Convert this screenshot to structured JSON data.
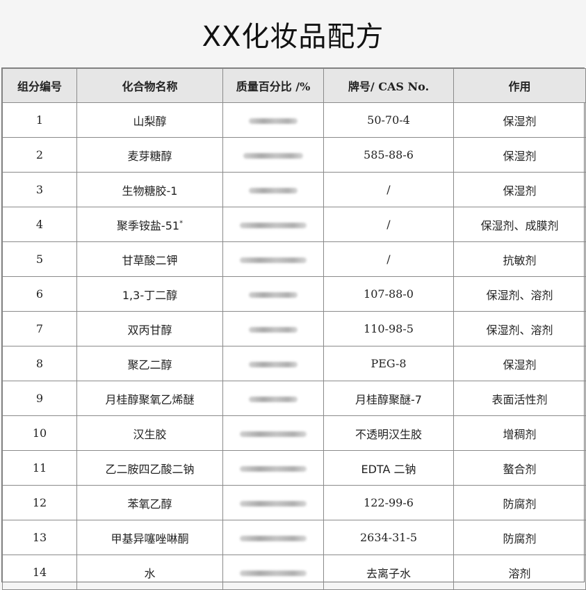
{
  "title": "XX化妆品配方",
  "columns": [
    "组分编号",
    "化合物名称",
    "质量百分比 /%",
    "牌号/ CAS No.",
    "作用"
  ],
  "rows": [
    {
      "id": "1",
      "name": "山梨醇",
      "sup": "",
      "cas": "50-70-4",
      "role": "保湿剂"
    },
    {
      "id": "2",
      "name": "麦芽糖醇",
      "sup": "",
      "cas": "585-88-6",
      "role": "保湿剂"
    },
    {
      "id": "3",
      "name": "生物糖胶-1",
      "sup": "",
      "cas": "/",
      "role": "保湿剂"
    },
    {
      "id": "4",
      "name": "聚季铵盐-51",
      "sup": "*",
      "cas": "/",
      "role": "保湿剂、成膜剂"
    },
    {
      "id": "5",
      "name": "甘草酸二钾",
      "sup": "",
      "cas": "/",
      "role": "抗敏剂"
    },
    {
      "id": "6",
      "name": "1,3-丁二醇",
      "sup": "",
      "cas": "107-88-0",
      "role": "保湿剂、溶剂"
    },
    {
      "id": "7",
      "name": "双丙甘醇",
      "sup": "",
      "cas": "110-98-5",
      "role": "保湿剂、溶剂"
    },
    {
      "id": "8",
      "name": "聚乙二醇",
      "sup": "",
      "cas": "PEG-8",
      "role": "保湿剂"
    },
    {
      "id": "9",
      "name": "月桂醇聚氧乙烯醚",
      "sup": "",
      "cas": "月桂醇聚醚-7",
      "role": "表面活性剂"
    },
    {
      "id": "10",
      "name": "汉生胶",
      "sup": "",
      "cas": "不透明汉生胶",
      "role": "增稠剂"
    },
    {
      "id": "11",
      "name": "乙二胺四乙酸二钠",
      "sup": "",
      "cas": "EDTA 二钠",
      "role": "螯合剂"
    },
    {
      "id": "12",
      "name": "苯氧乙醇",
      "sup": "",
      "cas": "122-99-6",
      "role": "防腐剂"
    },
    {
      "id": "13",
      "name": "甲基异噻唑啉酮",
      "sup": "",
      "cas": "2634-31-5",
      "role": "防腐剂"
    },
    {
      "id": "14",
      "name": "水",
      "sup": "",
      "cas": "去离子水",
      "role": "溶剂"
    }
  ]
}
